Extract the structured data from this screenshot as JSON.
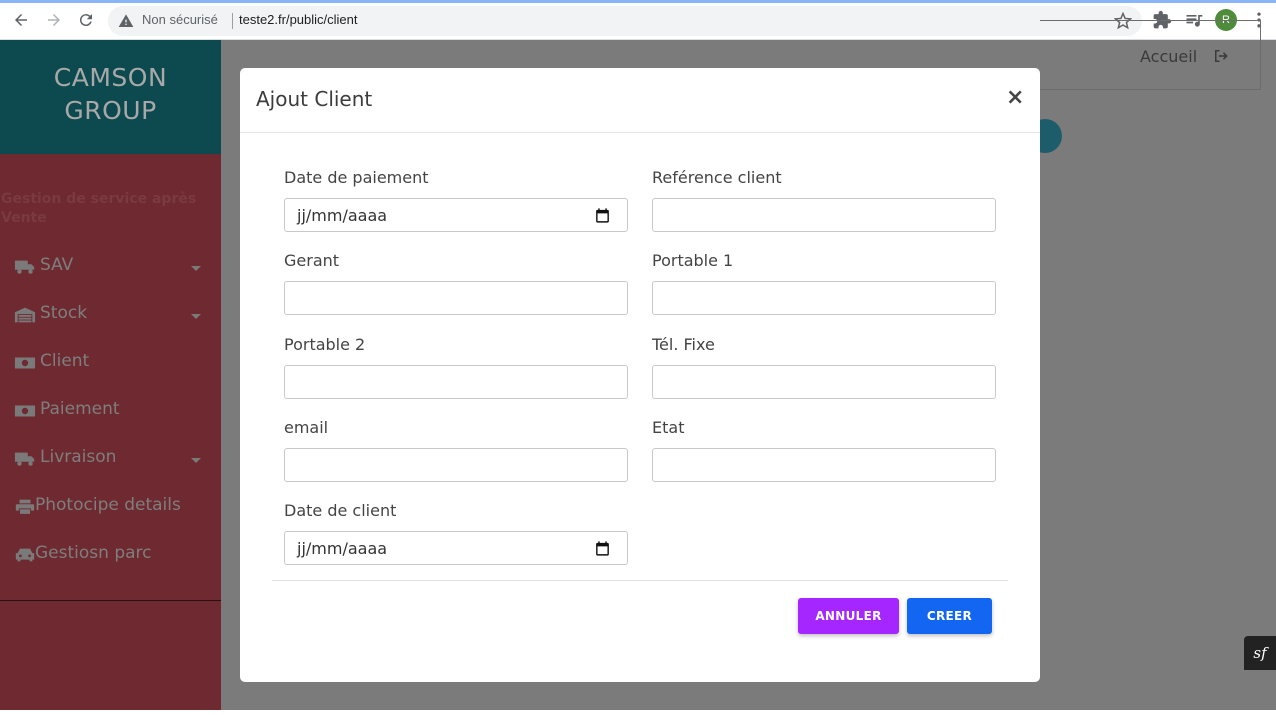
{
  "browser": {
    "insecure_label": "Non sécurisé",
    "url": "teste2.fr/public/client",
    "profile_initial": "R"
  },
  "sidebar": {
    "brand_line1": "CAMSON",
    "brand_line2": "GROUP",
    "subtitle": "Gestion de service après Vente",
    "items": [
      {
        "label": "SAV",
        "icon": "truck-icon",
        "has_caret": true
      },
      {
        "label": "Stock",
        "icon": "warehouse-icon",
        "has_caret": true
      },
      {
        "label": "Client",
        "icon": "money-icon",
        "has_caret": false
      },
      {
        "label": "Paiement",
        "icon": "money-icon",
        "has_caret": false
      },
      {
        "label": "Livraison",
        "icon": "truck-icon",
        "has_caret": true
      },
      {
        "label": "Photocipe details",
        "icon": "printer-icon",
        "has_caret": false
      },
      {
        "label": "Gestiosn parc",
        "icon": "car-icon",
        "has_caret": false
      }
    ]
  },
  "topbar": {
    "home_label": "Accueil"
  },
  "modal": {
    "title": "Ajout Client",
    "close_symbol": "×",
    "fields": {
      "date_paiement": {
        "label": "Date de paiement",
        "placeholder": "jj/mm/aaaa"
      },
      "reference_client": {
        "label": "Reférence client",
        "value": ""
      },
      "gerant": {
        "label": "Gerant",
        "value": ""
      },
      "portable1": {
        "label": "Portable 1",
        "value": ""
      },
      "portable2": {
        "label": "Portable 2",
        "value": ""
      },
      "tel_fixe": {
        "label": "Tél. Fixe",
        "value": ""
      },
      "email": {
        "label": "email",
        "value": ""
      },
      "etat": {
        "label": "Etat",
        "value": ""
      },
      "date_client": {
        "label": "Date de client",
        "placeholder": "jj/mm/aaaa"
      }
    },
    "cancel_label": "ANNULER",
    "create_label": "CREER"
  },
  "colors": {
    "brand_bg": "#0c4a4f",
    "sidebar_bg": "#6e2a30",
    "cancel_button": "#a626ff",
    "create_button": "#1266f1"
  }
}
